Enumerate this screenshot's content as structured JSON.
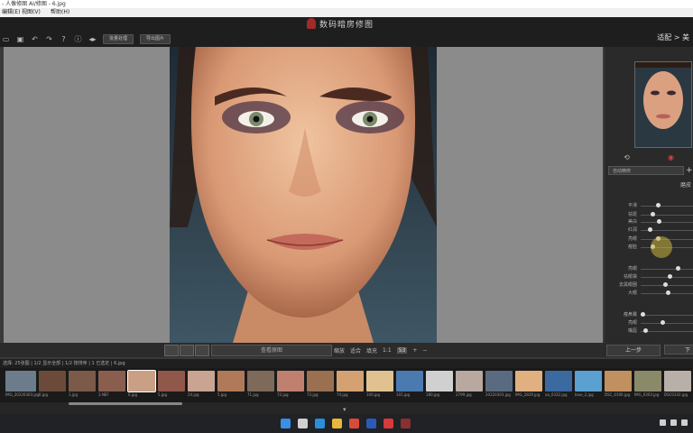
{
  "window": {
    "title": "- 人像修图 AI/修图 - 6.jpg"
  },
  "menu": [
    "编辑(E)",
    "视图(V)",
    "帮助(H)"
  ],
  "app": {
    "brand": "数码暗房修图",
    "mode_label": "适配 > 美"
  },
  "toolbar": {
    "icons": [
      "open-icon",
      "save-icon",
      "undo-icon",
      "redo-icon",
      "help-icon",
      "info-icon",
      "compare-icon"
    ],
    "btn1": "批量处理",
    "btn2": "导出图片"
  },
  "panel": {
    "preset": "自动精修",
    "add": "+",
    "cut_label": "磨皮",
    "sliders": [
      {
        "label": "平滑",
        "value": 0.3
      },
      {
        "label": "祛斑",
        "value": 0.2
      },
      {
        "label": "美白",
        "value": 0.33
      },
      {
        "label": "红润",
        "value": 0.15
      },
      {
        "label": "亮眼",
        "value": 0.3
      },
      {
        "label": "瘦脸",
        "value": 0.2
      },
      {
        "label": "亮眼",
        "value": 0.7
      },
      {
        "label": "祛眼袋",
        "value": 0.55
      },
      {
        "label": "去黑眼圈",
        "value": 0.45
      },
      {
        "label": "大眼",
        "value": 0.5
      },
      {
        "label": "瘦鼻翼",
        "value": 0.0
      },
      {
        "label": "亮眼",
        "value": 0.4
      },
      {
        "label": "嘴唇",
        "value": 0.05
      }
    ],
    "prev": "上一步",
    "next": "下一步"
  },
  "viewbar": {
    "mode": "查看原图",
    "zoom_label": "缩放",
    "fit": "适合",
    "zoom_text": "填充",
    "ratio": "1:1",
    "zoom_value": "53",
    "plus": "+",
    "minus": "−"
  },
  "filmstrip": {
    "info": "选择: 25张图 | 1/2 显示全部 | 1/2 按排序 | 1 已选定 | 6.jpg",
    "frames": [
      {
        "label": "IMG_20220303.jpg",
        "color": "#6d7c8a"
      },
      {
        "label": "0.jpg",
        "color": "#6b4a3a"
      },
      {
        "label": "1.jpg",
        "color": "#7b5a4a"
      },
      {
        "label": "3.NEF",
        "color": "#8a5e4e"
      },
      {
        "label": "6.jpg",
        "color": "#caa085"
      },
      {
        "label": "5.jpg",
        "color": "#90584a"
      },
      {
        "label": "24.jpg",
        "color": "#c9a493"
      },
      {
        "label": "5.jpg",
        "color": "#b07a5a"
      },
      {
        "label": "71.jpg",
        "color": "#7e6a5a"
      },
      {
        "label": "72.jpg",
        "color": "#c08070"
      },
      {
        "label": "73.jpg",
        "color": "#9a7050"
      },
      {
        "label": "74.jpg",
        "color": "#d4a272"
      },
      {
        "label": "100.jpg",
        "color": "#e0c290"
      },
      {
        "label": "101.jpg",
        "color": "#4a7ab0"
      },
      {
        "label": "180.jpg",
        "color": "#d0d0d0"
      },
      {
        "label": "2799.jpg",
        "color": "#b8a8a0"
      },
      {
        "label": "20220303.jpg",
        "color": "#5a6a80"
      },
      {
        "label": "IMG_2829.jpg",
        "color": "#e0b080"
      },
      {
        "label": "aa_0332.jpg",
        "color": "#3a6aa0"
      },
      {
        "label": "blue_2.jpg",
        "color": "#5aa0d0"
      },
      {
        "label": "DSC_0100.jpg",
        "color": "#c09060"
      },
      {
        "label": "IMG_0303.jpg",
        "color": "#8a8a6a"
      },
      {
        "label": "DSC0332.jpg",
        "color": "#b8b0a8"
      }
    ]
  },
  "taskbar": {
    "icons": [
      {
        "name": "start-icon",
        "color": "#3a8ee6"
      },
      {
        "name": "search-icon",
        "color": "#d0d0d0"
      },
      {
        "name": "edge-icon",
        "color": "#2a8fd8"
      },
      {
        "name": "explorer-icon",
        "color": "#e8b83a"
      },
      {
        "name": "chrome-icon",
        "color": "#d84a3a"
      },
      {
        "name": "word-icon",
        "color": "#2a5ab8"
      },
      {
        "name": "record-icon",
        "color": "#d83a3a"
      },
      {
        "name": "app-icon",
        "color": "#8a3030"
      }
    ]
  }
}
